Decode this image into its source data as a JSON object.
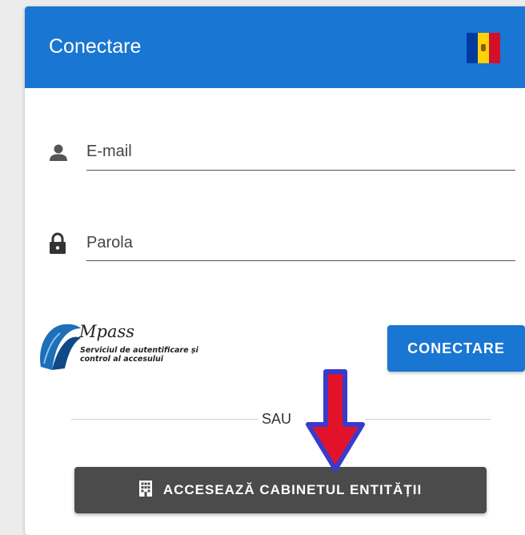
{
  "header": {
    "title": "Conectare",
    "flag_icon": "moldova-flag-icon"
  },
  "form": {
    "email": {
      "placeholder": "E-mail",
      "icon": "person-icon"
    },
    "password": {
      "placeholder": "Parola",
      "icon": "lock-icon"
    }
  },
  "mpass": {
    "wordmark": "Mpass",
    "tagline_line1": "Serviciul de autentificare și",
    "tagline_line2": "control al accesului"
  },
  "buttons": {
    "connect_label": "CONECTARE",
    "entity_label": "ACCESEAZĂ CABINETUL ENTITĂȚII"
  },
  "separator": {
    "label": "SAU"
  },
  "colors": {
    "primary": "#1976d2",
    "dark_button": "#4b4b4b",
    "annotation_arrow_fill": "#e3122b",
    "annotation_arrow_stroke": "#3a3acb"
  }
}
